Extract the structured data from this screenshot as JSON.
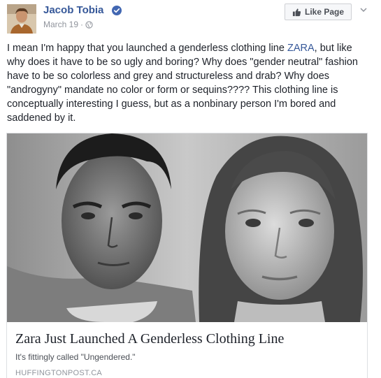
{
  "post": {
    "author": "Jacob Tobia",
    "date": "March 19",
    "separator": "·",
    "like_page_label": "Like Page",
    "text_before_link": "I mean I'm happy that you launched a genderless clothing line ",
    "link_text": "ZARA",
    "text_after_link": ", but like why does it have to be so ugly and boring? Why does \"gender neutral\" fashion have to be so colorless and grey and structureless and drab? Why does \"androgyny\" mandate no color or form or sequins???? This clothing line is conceptually interesting I guess, but as a nonbinary person I'm bored and saddened by it."
  },
  "link_card": {
    "title": "Zara Just Launched A Genderless Clothing Line",
    "subtitle": "It's fittingly called \"Ungendered.\"",
    "domain": "HUFFINGTONPOST.CA"
  },
  "colors": {
    "link_blue": "#365899",
    "verified_blue": "#4267b2",
    "meta_grey": "#90949c"
  },
  "icons": [
    "avatar",
    "verified-badge-icon",
    "globe-icon",
    "thumbs-up-icon",
    "chevron-down-icon"
  ]
}
